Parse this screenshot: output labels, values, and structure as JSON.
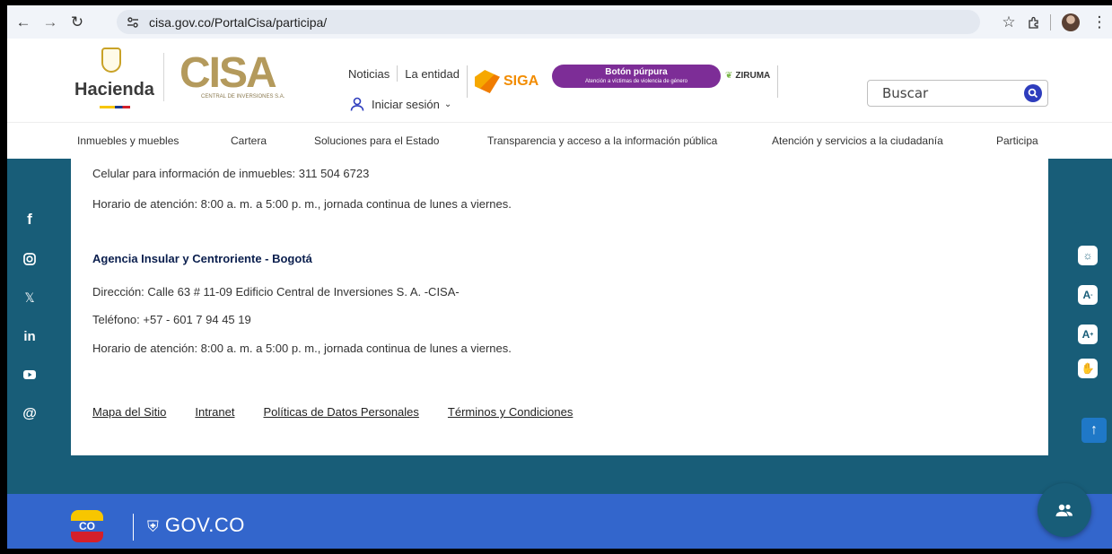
{
  "browser": {
    "url": "cisa.gov.co/PortalCisa/participa/"
  },
  "header": {
    "hacienda_logo": "Hacienda",
    "cisa_logo": "CISA",
    "cisa_subtitle": "CENTRAL DE INVERSIONES S.A.",
    "top_links": [
      "Noticias",
      "La entidad"
    ],
    "login_label": "Iniciar sesión",
    "siga_label": "SIGA",
    "purple_button_title": "Botón púrpura",
    "purple_button_subtitle": "Atención a víctimas de violencia de género",
    "ziruma_label": "ZIRUMA",
    "search_placeholder": "Buscar"
  },
  "nav": {
    "items": [
      "Inmuebles y muebles",
      "Cartera",
      "Soluciones para el Estado",
      "Transparencia y acceso a la información pública",
      "Atención y servicios a la ciudadanía",
      "Participa"
    ]
  },
  "content": {
    "celular": "Celular para información de inmuebles: 311 504 6723",
    "horario_1": "Horario de atención: 8:00 a. m. a 5:00 p. m., jornada continua de lunes a viernes.",
    "agency_title": "Agencia Insular y Centroriente - Bogotá",
    "direccion": "Dirección: Calle 63 # 11-09 Edificio Central de Inversiones S. A. -CISA-",
    "telefono": "Teléfono:  +57 - 601 7 94 45 19",
    "horario_2": "Horario de atención: 8:00 a. m. a 5:00 p. m., jornada continua de lunes a viernes."
  },
  "footer_links": [
    "Mapa del Sitio",
    "Intranet",
    "Políticas de Datos Personales",
    "Términos y Condiciones"
  ],
  "social_icons": [
    "facebook-icon",
    "instagram-icon",
    "x-icon",
    "linkedin-icon",
    "youtube-icon",
    "threads-icon"
  ],
  "gov_bar": {
    "co_badge": "CO",
    "gov_label": "GOV.CO"
  },
  "colors": {
    "teal": "#185d78",
    "gov_blue": "#3366cc",
    "purple": "#7d2d97",
    "cisa_gold": "#b49a5c"
  }
}
